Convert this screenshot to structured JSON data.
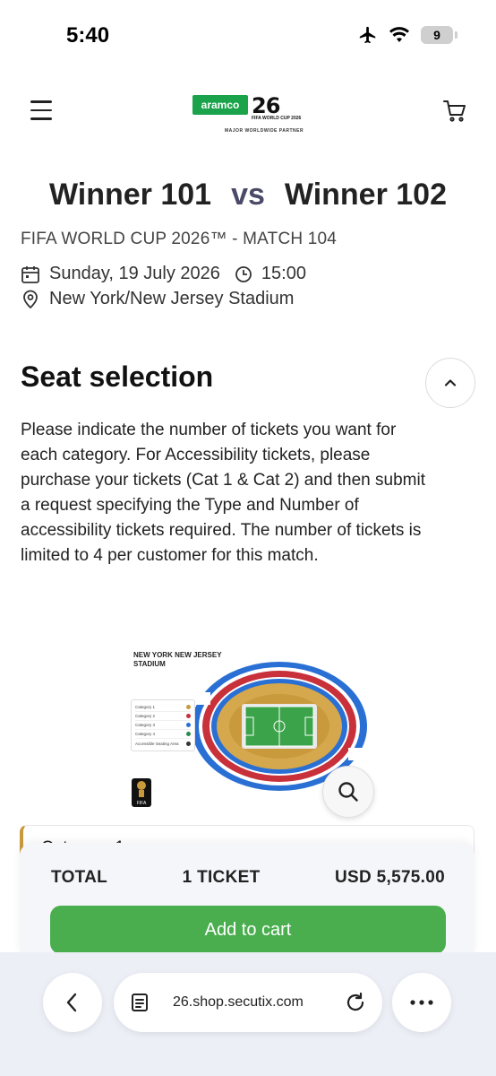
{
  "status_bar": {
    "time": "5:40",
    "battery": "9"
  },
  "header": {
    "logo": {
      "brand": "aramco",
      "mark": "26",
      "event": "FIFA WORLD CUP 2026",
      "partner": "MAJOR WORLDWIDE PARTNER"
    }
  },
  "match": {
    "team_home": "Winner 101",
    "vs": "vs",
    "team_away": "Winner 102",
    "subtitle": "FIFA WORLD CUP 2026™  - MATCH 104",
    "date": "Sunday, 19 July 2026",
    "time": "15:00",
    "venue": "New York/New Jersey Stadium"
  },
  "seat_selection": {
    "heading": "Seat selection",
    "description": "Please indicate the number of tickets you want for each category. For Accessibility tickets, please purchase your tickets (Cat 1 & Cat 2) and then submit a request specifying the Type and Number of accessibility tickets required. The number of tickets is limited to 4 per customer for this match."
  },
  "stadium_map": {
    "title": "NEW YORK NEW JERSEY STADIUM",
    "legend": [
      {
        "label": "Category 1",
        "color": "#c99a3c"
      },
      {
        "label": "Category 2",
        "color": "#c8303a"
      },
      {
        "label": "Category 3",
        "color": "#2a6fd4"
      },
      {
        "label": "Category 4",
        "color": "#2a8a4a"
      },
      {
        "label": "Accessible Seating Area",
        "color": "#333333"
      }
    ],
    "fifa_logo_text": "FIFA"
  },
  "category_card": {
    "label": "Category 1"
  },
  "total": {
    "label": "TOTAL",
    "tickets": "1 TICKET",
    "amount": "USD 5,575.00",
    "add_to_cart": "Add to cart"
  },
  "browser": {
    "url": "26.shop.secutix.com"
  },
  "colors": {
    "accent_green": "#4aae4f",
    "category1_gold": "#c99a3c",
    "category2_red": "#c8303a",
    "category3_blue": "#2a6fd4"
  }
}
